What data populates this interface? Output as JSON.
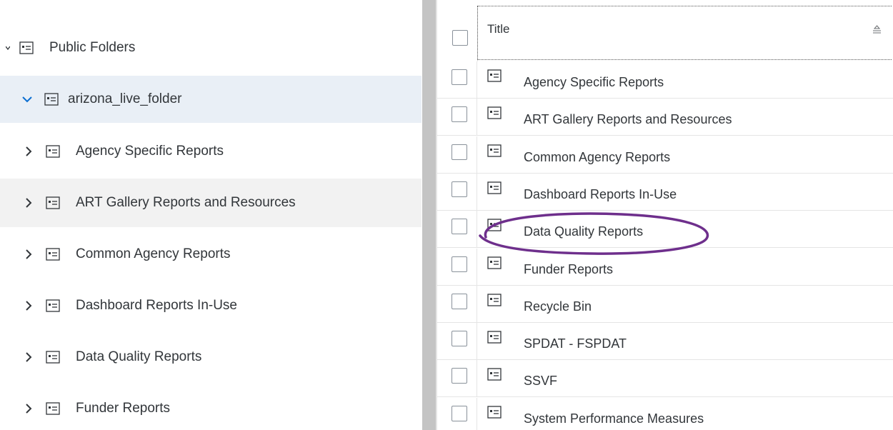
{
  "tree": {
    "root_label": "Public Folders",
    "items": [
      {
        "label": "arizona_live_folder",
        "expanded": true,
        "selected": true
      },
      {
        "label": "Agency Specific Reports",
        "expanded": false
      },
      {
        "label": "ART Gallery Reports and Resources",
        "expanded": false,
        "hovered": true
      },
      {
        "label": "Common Agency Reports",
        "expanded": false
      },
      {
        "label": "Dashboard Reports In-Use",
        "expanded": false
      },
      {
        "label": "Data Quality Reports",
        "expanded": false
      },
      {
        "label": "Funder Reports",
        "expanded": false
      }
    ]
  },
  "list": {
    "column_title": "Title",
    "rows": [
      {
        "label": "Agency Specific Reports"
      },
      {
        "label": "ART Gallery Reports and Resources"
      },
      {
        "label": "Common Agency Reports"
      },
      {
        "label": "Dashboard Reports In-Use"
      },
      {
        "label": "Data Quality Reports",
        "annotated": true
      },
      {
        "label": "Funder Reports"
      },
      {
        "label": "Recycle Bin"
      },
      {
        "label": "SPDAT - FSPDAT"
      },
      {
        "label": "SSVF"
      },
      {
        "label": "System Performance Measures"
      }
    ]
  },
  "colors": {
    "selected_row": "#e9eff6",
    "hover_row": "#f2f2f2",
    "annotation": "#6e2f8c",
    "splitter": "#c4c4c4"
  }
}
